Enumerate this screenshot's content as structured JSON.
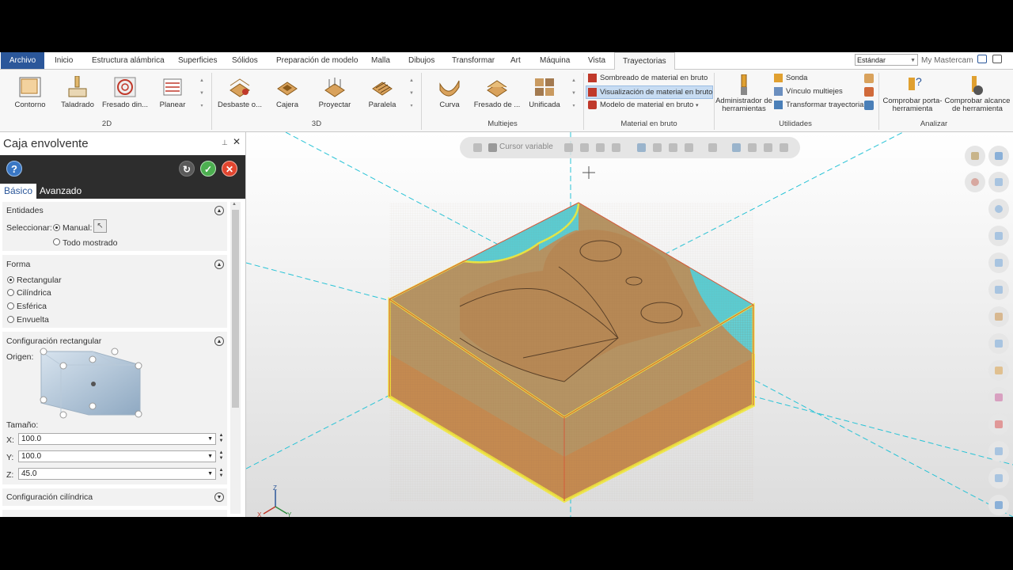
{
  "menu": {
    "file": "Archivo",
    "tabs": [
      "Inicio",
      "Estructura alámbrica",
      "Superficies",
      "Sólidos",
      "Preparación de modelo",
      "Malla",
      "Dibujos",
      "Transformar",
      "Art",
      "Máquina",
      "Vista"
    ],
    "active_tab": "Trayectorias",
    "mode": "Estándar",
    "account": "My Mastercam"
  },
  "ribbon": {
    "group_2d": {
      "label": "2D",
      "buttons": [
        "Contorno",
        "Taladrado",
        "Fresado din...",
        "Planear"
      ]
    },
    "group_3d": {
      "label": "3D",
      "buttons": [
        "Desbaste o...",
        "Cajera",
        "Proyectar",
        "Paralela"
      ]
    },
    "group_multi": {
      "label": "Multiejes",
      "buttons": [
        "Curva",
        "Fresado de ...",
        "Unificada"
      ]
    },
    "group_stock": {
      "label": "Material en bruto",
      "items": [
        "Sombreado de material en bruto",
        "Visualización de material en bruto",
        "Modelo de material en bruto"
      ]
    },
    "group_util": {
      "label": "Utilidades",
      "admin": "Administrador de herramientas",
      "items": [
        "Sonda",
        "Vínculo multiejes",
        "Transformar trayectoria"
      ]
    },
    "group_analyze": {
      "label": "Analizar",
      "check_holder": "Comprobar porta-herramienta",
      "check_reach": "Comprobar alcance de herramienta"
    }
  },
  "panel": {
    "title": "Caja envolvente",
    "tabs": {
      "basic": "Básico",
      "advanced": "Avanzado"
    },
    "entities": {
      "header": "Entidades",
      "select_label": "Seleccionar:",
      "manual": "Manual:",
      "all_shown": "Todo mostrado"
    },
    "shape": {
      "header": "Forma",
      "options": [
        "Rectangular",
        "Cilíndrica",
        "Esférica",
        "Envuelta"
      ],
      "selected": "Rectangular"
    },
    "rect_config": {
      "header": "Configuración rectangular",
      "origin_label": "Origen:",
      "size_label": "Tamaño:",
      "x_label": "X:",
      "x": "100.0",
      "y_label": "Y:",
      "y": "100.0",
      "z_label": "Z:",
      "z": "45.0"
    },
    "cyl_config": {
      "header": "Configuración cilíndrica"
    }
  },
  "viewport": {
    "toolbar_text": "Cursor variable",
    "axis_labels": {
      "z": "Z",
      "x": "X",
      "y": "Y"
    }
  },
  "colors": {
    "file_tab": "#2b579a",
    "stock_cyan": "#5ccbd0",
    "part_orange": "#c48a50",
    "highlight_yellow": "#f2ea3a",
    "axis_cyan": "#27c3d6"
  }
}
